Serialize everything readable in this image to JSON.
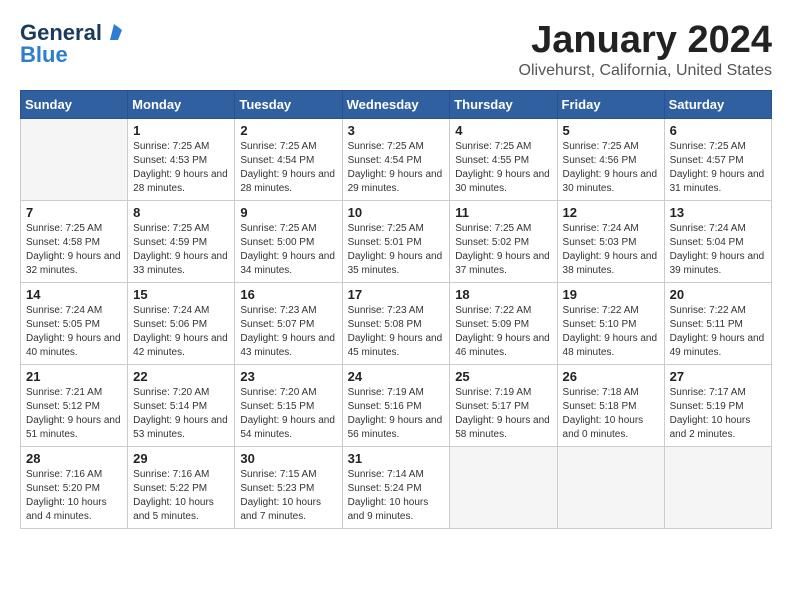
{
  "logo": {
    "part1": "General",
    "part2": "Blue"
  },
  "title": "January 2024",
  "subtitle": "Olivehurst, California, United States",
  "days_of_week": [
    "Sunday",
    "Monday",
    "Tuesday",
    "Wednesday",
    "Thursday",
    "Friday",
    "Saturday"
  ],
  "weeks": [
    [
      {
        "day": "",
        "sunrise": "",
        "sunset": "",
        "daylight": "",
        "empty": true
      },
      {
        "day": "1",
        "sunrise": "Sunrise: 7:25 AM",
        "sunset": "Sunset: 4:53 PM",
        "daylight": "Daylight: 9 hours and 28 minutes."
      },
      {
        "day": "2",
        "sunrise": "Sunrise: 7:25 AM",
        "sunset": "Sunset: 4:54 PM",
        "daylight": "Daylight: 9 hours and 28 minutes."
      },
      {
        "day": "3",
        "sunrise": "Sunrise: 7:25 AM",
        "sunset": "Sunset: 4:54 PM",
        "daylight": "Daylight: 9 hours and 29 minutes."
      },
      {
        "day": "4",
        "sunrise": "Sunrise: 7:25 AM",
        "sunset": "Sunset: 4:55 PM",
        "daylight": "Daylight: 9 hours and 30 minutes."
      },
      {
        "day": "5",
        "sunrise": "Sunrise: 7:25 AM",
        "sunset": "Sunset: 4:56 PM",
        "daylight": "Daylight: 9 hours and 30 minutes."
      },
      {
        "day": "6",
        "sunrise": "Sunrise: 7:25 AM",
        "sunset": "Sunset: 4:57 PM",
        "daylight": "Daylight: 9 hours and 31 minutes."
      }
    ],
    [
      {
        "day": "7",
        "sunrise": "Sunrise: 7:25 AM",
        "sunset": "Sunset: 4:58 PM",
        "daylight": "Daylight: 9 hours and 32 minutes."
      },
      {
        "day": "8",
        "sunrise": "Sunrise: 7:25 AM",
        "sunset": "Sunset: 4:59 PM",
        "daylight": "Daylight: 9 hours and 33 minutes."
      },
      {
        "day": "9",
        "sunrise": "Sunrise: 7:25 AM",
        "sunset": "Sunset: 5:00 PM",
        "daylight": "Daylight: 9 hours and 34 minutes."
      },
      {
        "day": "10",
        "sunrise": "Sunrise: 7:25 AM",
        "sunset": "Sunset: 5:01 PM",
        "daylight": "Daylight: 9 hours and 35 minutes."
      },
      {
        "day": "11",
        "sunrise": "Sunrise: 7:25 AM",
        "sunset": "Sunset: 5:02 PM",
        "daylight": "Daylight: 9 hours and 37 minutes."
      },
      {
        "day": "12",
        "sunrise": "Sunrise: 7:24 AM",
        "sunset": "Sunset: 5:03 PM",
        "daylight": "Daylight: 9 hours and 38 minutes."
      },
      {
        "day": "13",
        "sunrise": "Sunrise: 7:24 AM",
        "sunset": "Sunset: 5:04 PM",
        "daylight": "Daylight: 9 hours and 39 minutes."
      }
    ],
    [
      {
        "day": "14",
        "sunrise": "Sunrise: 7:24 AM",
        "sunset": "Sunset: 5:05 PM",
        "daylight": "Daylight: 9 hours and 40 minutes."
      },
      {
        "day": "15",
        "sunrise": "Sunrise: 7:24 AM",
        "sunset": "Sunset: 5:06 PM",
        "daylight": "Daylight: 9 hours and 42 minutes."
      },
      {
        "day": "16",
        "sunrise": "Sunrise: 7:23 AM",
        "sunset": "Sunset: 5:07 PM",
        "daylight": "Daylight: 9 hours and 43 minutes."
      },
      {
        "day": "17",
        "sunrise": "Sunrise: 7:23 AM",
        "sunset": "Sunset: 5:08 PM",
        "daylight": "Daylight: 9 hours and 45 minutes."
      },
      {
        "day": "18",
        "sunrise": "Sunrise: 7:22 AM",
        "sunset": "Sunset: 5:09 PM",
        "daylight": "Daylight: 9 hours and 46 minutes."
      },
      {
        "day": "19",
        "sunrise": "Sunrise: 7:22 AM",
        "sunset": "Sunset: 5:10 PM",
        "daylight": "Daylight: 9 hours and 48 minutes."
      },
      {
        "day": "20",
        "sunrise": "Sunrise: 7:22 AM",
        "sunset": "Sunset: 5:11 PM",
        "daylight": "Daylight: 9 hours and 49 minutes."
      }
    ],
    [
      {
        "day": "21",
        "sunrise": "Sunrise: 7:21 AM",
        "sunset": "Sunset: 5:12 PM",
        "daylight": "Daylight: 9 hours and 51 minutes."
      },
      {
        "day": "22",
        "sunrise": "Sunrise: 7:20 AM",
        "sunset": "Sunset: 5:14 PM",
        "daylight": "Daylight: 9 hours and 53 minutes."
      },
      {
        "day": "23",
        "sunrise": "Sunrise: 7:20 AM",
        "sunset": "Sunset: 5:15 PM",
        "daylight": "Daylight: 9 hours and 54 minutes."
      },
      {
        "day": "24",
        "sunrise": "Sunrise: 7:19 AM",
        "sunset": "Sunset: 5:16 PM",
        "daylight": "Daylight: 9 hours and 56 minutes."
      },
      {
        "day": "25",
        "sunrise": "Sunrise: 7:19 AM",
        "sunset": "Sunset: 5:17 PM",
        "daylight": "Daylight: 9 hours and 58 minutes."
      },
      {
        "day": "26",
        "sunrise": "Sunrise: 7:18 AM",
        "sunset": "Sunset: 5:18 PM",
        "daylight": "Daylight: 10 hours and 0 minutes."
      },
      {
        "day": "27",
        "sunrise": "Sunrise: 7:17 AM",
        "sunset": "Sunset: 5:19 PM",
        "daylight": "Daylight: 10 hours and 2 minutes."
      }
    ],
    [
      {
        "day": "28",
        "sunrise": "Sunrise: 7:16 AM",
        "sunset": "Sunset: 5:20 PM",
        "daylight": "Daylight: 10 hours and 4 minutes."
      },
      {
        "day": "29",
        "sunrise": "Sunrise: 7:16 AM",
        "sunset": "Sunset: 5:22 PM",
        "daylight": "Daylight: 10 hours and 5 minutes."
      },
      {
        "day": "30",
        "sunrise": "Sunrise: 7:15 AM",
        "sunset": "Sunset: 5:23 PM",
        "daylight": "Daylight: 10 hours and 7 minutes."
      },
      {
        "day": "31",
        "sunrise": "Sunrise: 7:14 AM",
        "sunset": "Sunset: 5:24 PM",
        "daylight": "Daylight: 10 hours and 9 minutes."
      },
      {
        "day": "",
        "sunrise": "",
        "sunset": "",
        "daylight": "",
        "empty": true
      },
      {
        "day": "",
        "sunrise": "",
        "sunset": "",
        "daylight": "",
        "empty": true
      },
      {
        "day": "",
        "sunrise": "",
        "sunset": "",
        "daylight": "",
        "empty": true
      }
    ]
  ]
}
